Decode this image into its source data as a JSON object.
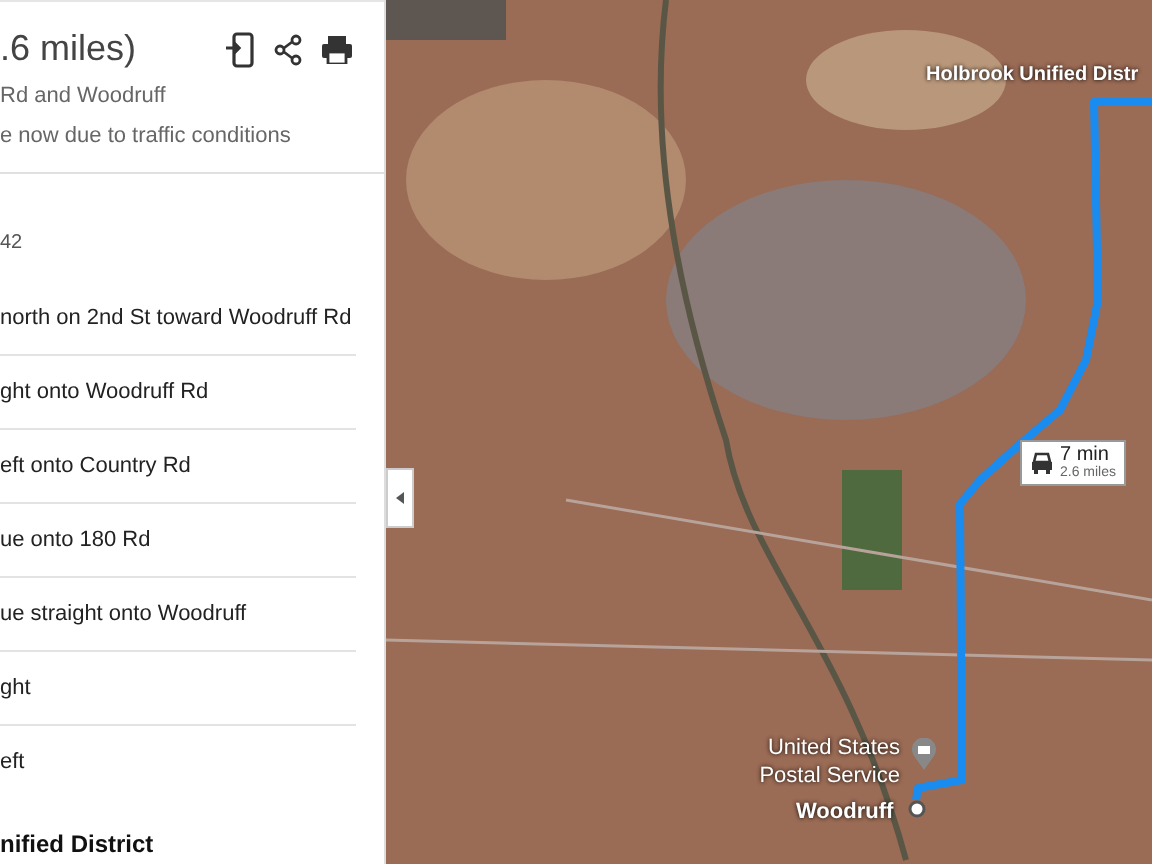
{
  "summary": {
    "title": ".6 miles)",
    "via": "Rd and Woodruff",
    "note": "e now due to traffic conditions"
  },
  "origin": "42",
  "steps": [
    {
      "text": "north on 2nd St toward Woodruff Rd",
      "bold": false
    },
    {
      "text": "ght onto Woodruff Rd",
      "bold": false
    },
    {
      "text": "eft onto Country Rd",
      "bold": false
    },
    {
      "text": "ue onto 180 Rd",
      "bold": false
    },
    {
      "text": "ue straight onto Woodruff",
      "bold": false
    },
    {
      "text": "ght",
      "bold": false
    },
    {
      "text": "eft",
      "bold": false
    },
    {
      "text": "nified District",
      "bold": true
    }
  ],
  "map": {
    "labels": [
      {
        "text": "Holbrook Unified Distr",
        "kind": "place"
      },
      {
        "text": "United States\nPostal Service",
        "kind": "poi"
      },
      {
        "text": "Woodruff",
        "kind": "town"
      }
    ],
    "route_callout": {
      "time": "7 min",
      "distance": "2.6 miles"
    }
  }
}
